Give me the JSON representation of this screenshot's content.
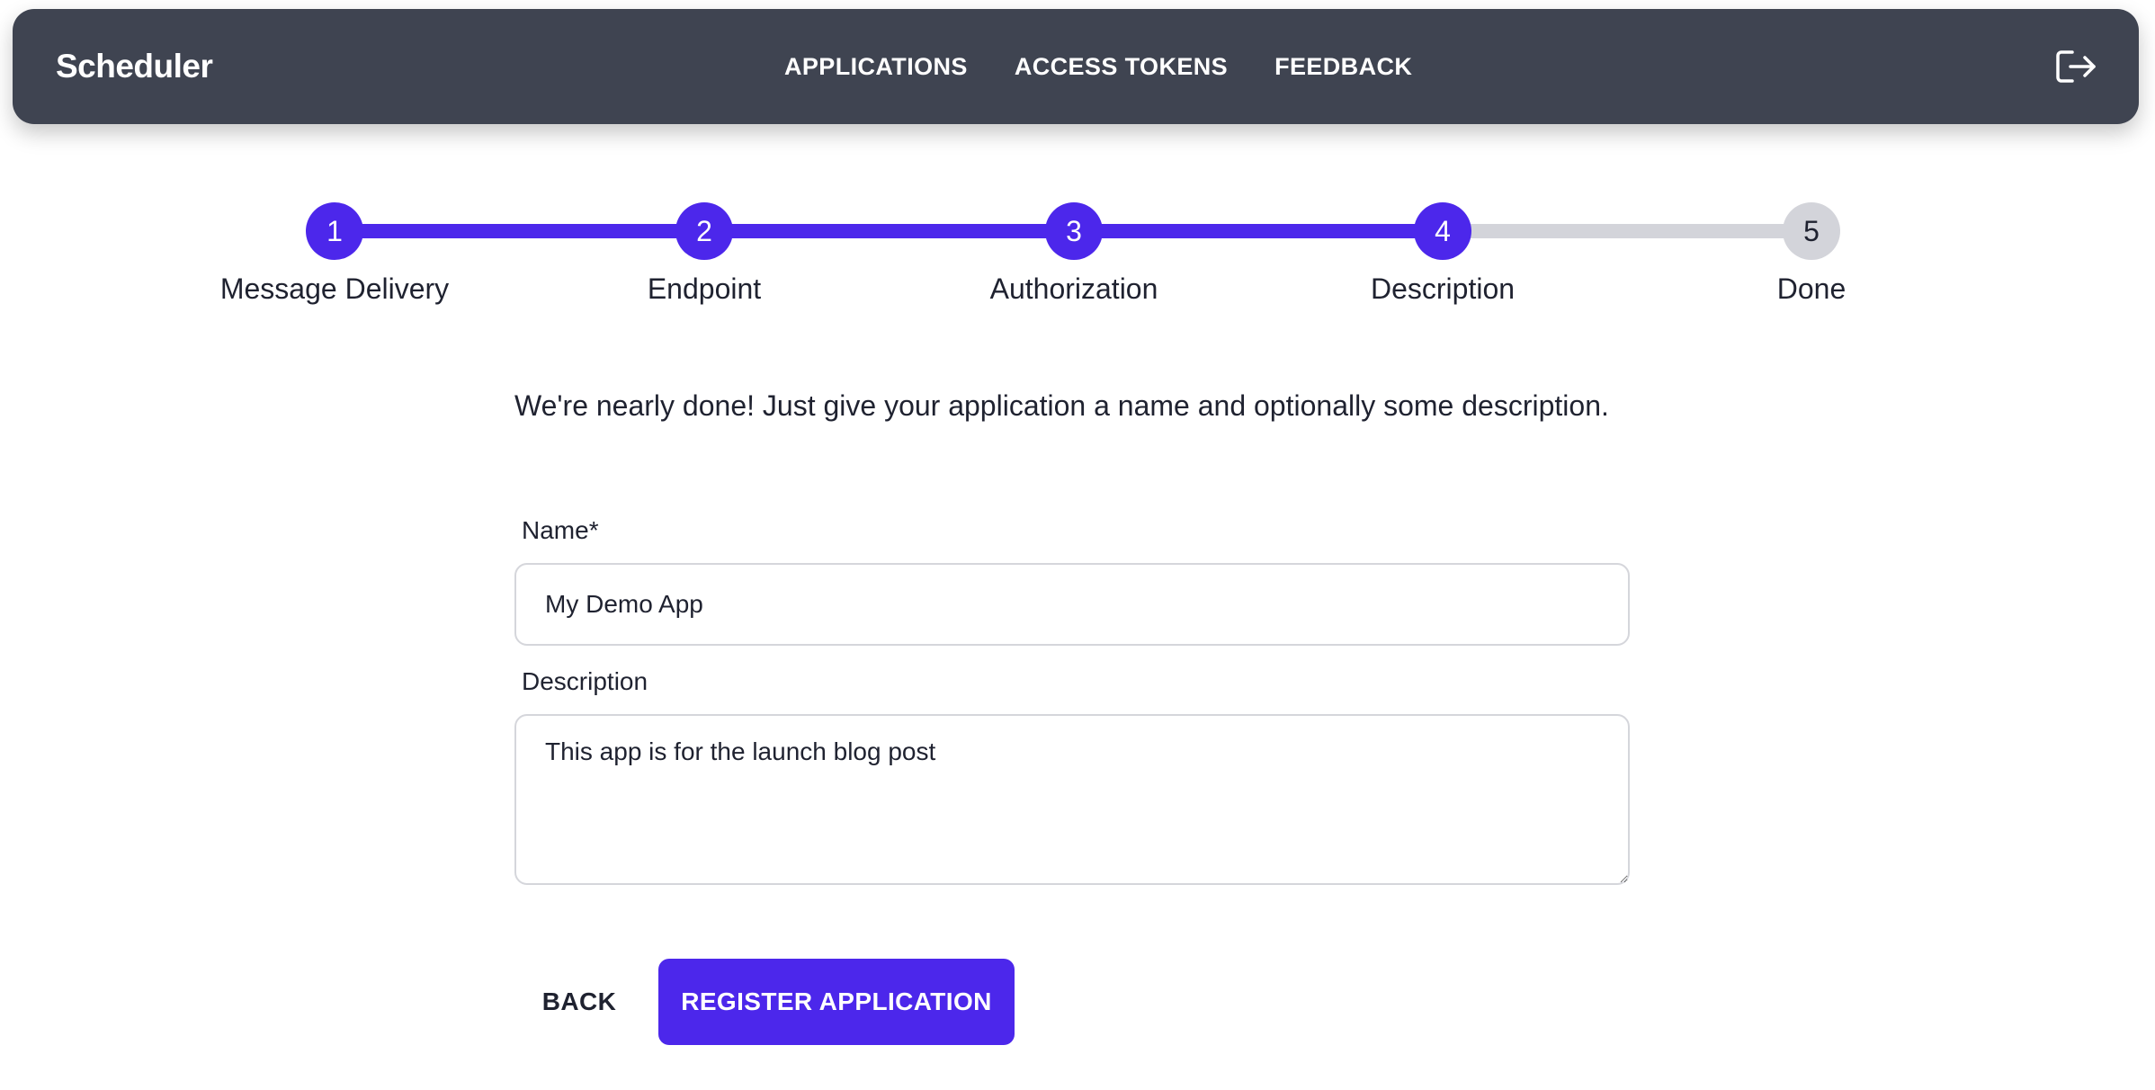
{
  "app": {
    "brand": "Scheduler"
  },
  "nav": {
    "links": [
      "APPLICATIONS",
      "ACCESS TOKENS",
      "FEEDBACK"
    ],
    "logout_icon": "logout-icon"
  },
  "stepper": {
    "current_step": 4,
    "steps": [
      {
        "number": "1",
        "label": "Message Delivery"
      },
      {
        "number": "2",
        "label": "Endpoint"
      },
      {
        "number": "3",
        "label": "Authorization"
      },
      {
        "number": "4",
        "label": "Description"
      },
      {
        "number": "5",
        "label": "Done"
      }
    ]
  },
  "form": {
    "intro": "We're nearly done! Just give your application a name and optionally some description.",
    "name_label": "Name*",
    "name_value": "My Demo App",
    "description_label": "Description",
    "description_value": "This app is for the launch blog post"
  },
  "actions": {
    "back_label": "BACK",
    "register_label": "REGISTER APPLICATION"
  },
  "colors": {
    "navbar": "#3f4451",
    "accent": "#4c27eb",
    "inactive": "#d3d4da"
  }
}
